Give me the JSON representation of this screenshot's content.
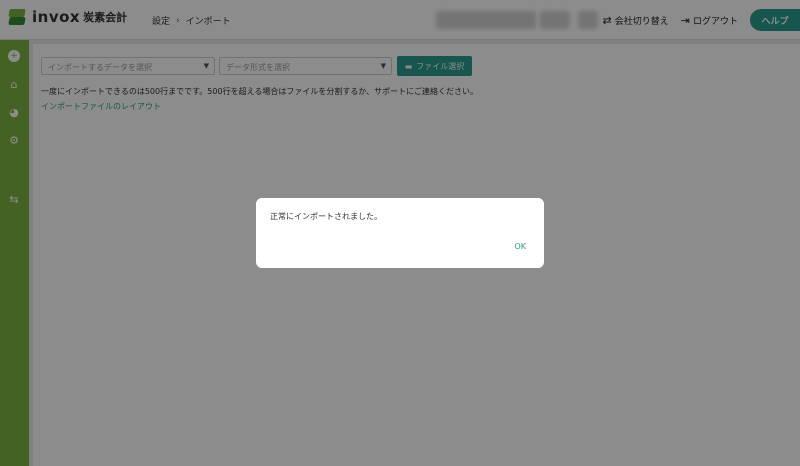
{
  "header": {
    "logo_text": "invox",
    "logo_sub": "炭素会計",
    "breadcrumb": [
      "設定",
      "インポート"
    ],
    "breadcrumb_sep": "›",
    "switch_company": "会社切り替え",
    "logout": "ログアウト",
    "help": "ヘルプ"
  },
  "sidebar": {
    "icons": [
      "add-circle-icon",
      "home-icon",
      "chart-icon",
      "gear-icon",
      "switch-icon"
    ]
  },
  "import": {
    "select_data_placeholder": "インポートするデータを選択",
    "select_format_placeholder": "データ形式を選択",
    "file_button": "ファイル選択",
    "notice": "一度にインポートできるのは500行までです。500行を超える場合はファイルを分割するか、サポートにご連絡ください。",
    "layout_link": "インポートファイルのレイアウト"
  },
  "modal": {
    "message": "正常にインポートされました。",
    "ok": "OK"
  },
  "colors": {
    "accent": "#2a9d8f",
    "sidebar": "#7cb342"
  }
}
